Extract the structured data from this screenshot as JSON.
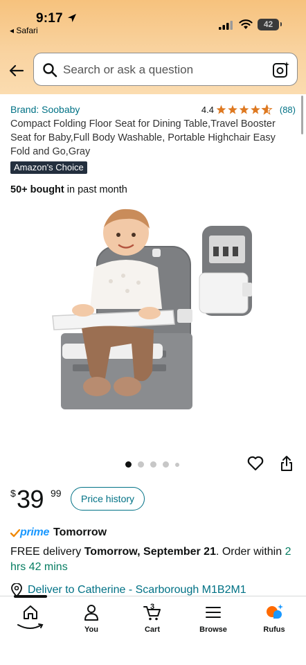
{
  "status_bar": {
    "time": "9:17",
    "back_app": "◂ Safari",
    "battery": "42"
  },
  "search": {
    "placeholder": "Search or ask a question"
  },
  "product": {
    "brand": "Brand: Soobaby",
    "rating": "4.4",
    "rating_value": 4.4,
    "rating_count": "(88)",
    "title": "Compact Folding Floor Seat for Dining Table,Travel Booster Seat for Baby,Full Body Washable, Portable Highchair Easy Fold and Go,Gray",
    "badge": "Amazon's Choice",
    "bought_bold": "50+ bought",
    "bought_rest": " in past month",
    "image_count": 5,
    "active_image": 1
  },
  "price": {
    "symbol": "$",
    "whole": "39",
    "fraction": "99",
    "history_button": "Price history"
  },
  "delivery": {
    "prime_label": "prime",
    "prime_day": "Tomorrow",
    "line_a": "FREE delivery ",
    "line_bold": "Tomorrow, September 21",
    "line_b": ". Order within ",
    "countdown": "2 hrs 42 mins",
    "deliver_to": "Deliver to Catherine - Scarborough M1B2M1"
  },
  "tabbar": {
    "items": [
      {
        "label": ""
      },
      {
        "label": "You"
      },
      {
        "label": "Cart"
      },
      {
        "label": "Browse"
      },
      {
        "label": "Rufus"
      }
    ],
    "cart_count": "3"
  },
  "colors": {
    "link": "#007185",
    "star": "#de7921",
    "prime_blue": "#1a98ff",
    "green": "#067d62",
    "header_top": "#f6c27d",
    "badge_bg": "#232f3e"
  }
}
